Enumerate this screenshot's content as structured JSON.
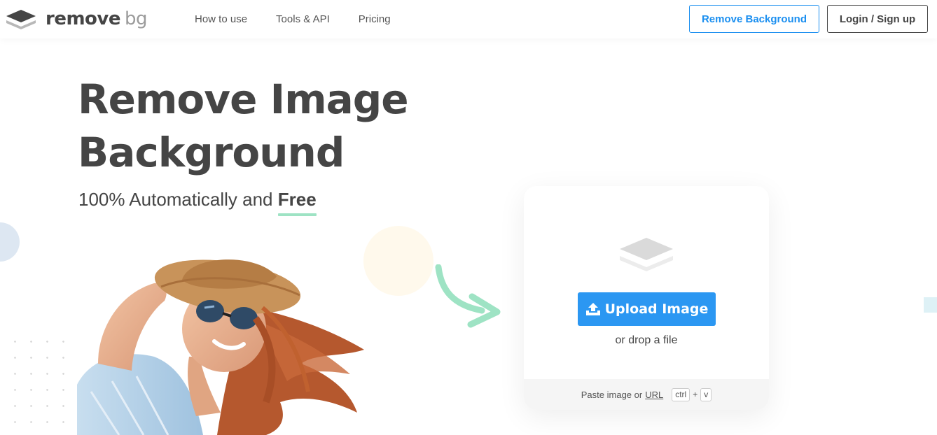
{
  "header": {
    "logo": {
      "word1": "remove",
      "word2": "bg"
    },
    "nav": [
      {
        "label": "How to use"
      },
      {
        "label": "Tools & API"
      },
      {
        "label": "Pricing"
      }
    ],
    "remove_background_label": "Remove Background",
    "login_label": "Login / Sign up"
  },
  "hero": {
    "title_line1": "Remove Image",
    "title_line2": "Background",
    "subtitle_prefix": "100% Automatically and",
    "subtitle_emphasis": "Free"
  },
  "upload": {
    "button_label": "Upload Image",
    "drop_text": "or drop a file",
    "paste_prefix": "Paste image or",
    "url_label": "URL",
    "key_ctrl": "ctrl",
    "key_plus": "+",
    "key_v": "v"
  },
  "icons": {
    "logo": "layers-icon",
    "card": "layers-icon",
    "upload": "upload-icon",
    "arrow": "curved-arrow-icon"
  },
  "colors": {
    "accent": "#2b97f2",
    "outline_accent": "#1b8ff0",
    "text": "#454545",
    "highlight": "#9ee3c4",
    "arrow": "#9ee3c4"
  }
}
